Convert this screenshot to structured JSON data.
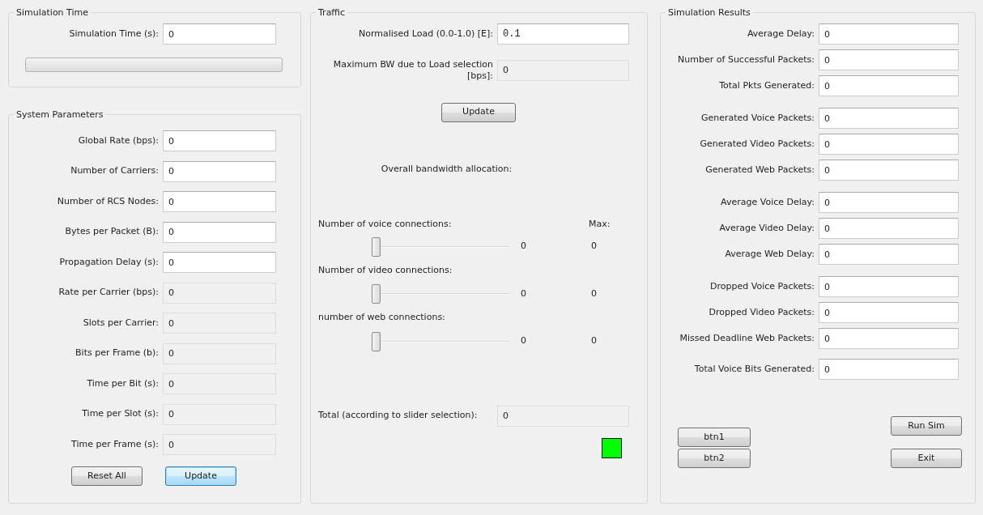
{
  "simulation_time": {
    "title": "Simulation Time",
    "fields": [
      {
        "label": "Simulation Time (s):",
        "value": "0",
        "readonly": false
      }
    ],
    "progress": {
      "level": 0
    }
  },
  "system_parameters": {
    "title": "System Parameters",
    "fields": [
      {
        "label": "Global Rate (bps):",
        "value": "0",
        "readonly": false
      },
      {
        "label": "Number of Carriers:",
        "value": "0",
        "readonly": false
      },
      {
        "label": "Number of RCS Nodes:",
        "value": "0",
        "readonly": false
      },
      {
        "label": "Bytes per Packet (B):",
        "value": "0",
        "readonly": false
      },
      {
        "label": "Propagation Delay (s):",
        "value": "0",
        "readonly": false
      },
      {
        "label": "Rate per Carrier (bps):",
        "value": "0",
        "readonly": true
      },
      {
        "label": "Slots per Carrier:",
        "value": "0",
        "readonly": true
      },
      {
        "label": "Bits per Frame (b):",
        "value": "0",
        "readonly": true
      },
      {
        "label": "Time per Bit (s):",
        "value": "0",
        "readonly": true
      },
      {
        "label": "Time per Slot (s):",
        "value": "0",
        "readonly": true
      },
      {
        "label": "Time per Frame (s):",
        "value": "0",
        "readonly": true
      }
    ],
    "buttons": [
      {
        "label": "Reset All",
        "default": false
      },
      {
        "label": "Update",
        "default": true
      }
    ]
  },
  "traffic": {
    "title": "Traffic",
    "fields": [
      {
        "label": "Normalised Load (0.0-1.0) [E]:",
        "value": "0.1",
        "readonly": false
      },
      {
        "label": "Maximum BW due to Load selection [bps]:",
        "value": "0",
        "readonly": true
      }
    ],
    "update_button": {
      "label": "Update",
      "default": false
    },
    "allocation_label": "Overall bandwidth allocation:",
    "max_heading": "Max:",
    "sliders": [
      {
        "label": "Number of voice connections:",
        "level": 0,
        "reading": "0",
        "max": "0"
      },
      {
        "label": "Number of video connections:",
        "level": 0,
        "reading": "0",
        "max": "0"
      },
      {
        "label": "number of web connections:",
        "level": 0,
        "reading": "0",
        "max": "0"
      }
    ],
    "total": {
      "label": "Total (according to slider selection):",
      "value": "0",
      "readonly": true
    },
    "indicator": {
      "color": "#00ff00"
    }
  },
  "simulation_results": {
    "title": "Simulation Results",
    "groups": [
      [
        {
          "label": "Average Delay:",
          "value": "0",
          "readonly": false
        },
        {
          "label": "Number of Successful Packets:",
          "value": "0",
          "readonly": false
        },
        {
          "label": "Total Pkts Generated:",
          "value": "0",
          "readonly": false
        }
      ],
      [
        {
          "label": "Generated Voice Packets:",
          "value": "0",
          "readonly": false
        },
        {
          "label": "Generated Video Packets:",
          "value": "0",
          "readonly": false
        },
        {
          "label": "Generated Web Packets:",
          "value": "0",
          "readonly": false
        }
      ],
      [
        {
          "label": "Average Voice Delay:",
          "value": "0",
          "readonly": false
        },
        {
          "label": "Average Video Delay:",
          "value": "0",
          "readonly": false
        },
        {
          "label": "Average Web Delay:",
          "value": "0",
          "readonly": false
        }
      ],
      [
        {
          "label": "Dropped Voice Packets:",
          "value": "0",
          "readonly": false
        },
        {
          "label": "Dropped Video Packets:",
          "value": "0",
          "readonly": false
        },
        {
          "label": "Missed Deadline Web Packets:",
          "value": "0",
          "readonly": false
        }
      ],
      [
        {
          "label": "Total Voice Bits Generated:",
          "value": "0",
          "readonly": false
        }
      ]
    ],
    "buttons": [
      {
        "label": "btn1",
        "default": false
      },
      {
        "label": "btn2",
        "default": false
      }
    ],
    "actions": [
      {
        "label": "Run Sim",
        "default": false
      },
      {
        "label": "Exit",
        "default": false
      }
    ]
  }
}
